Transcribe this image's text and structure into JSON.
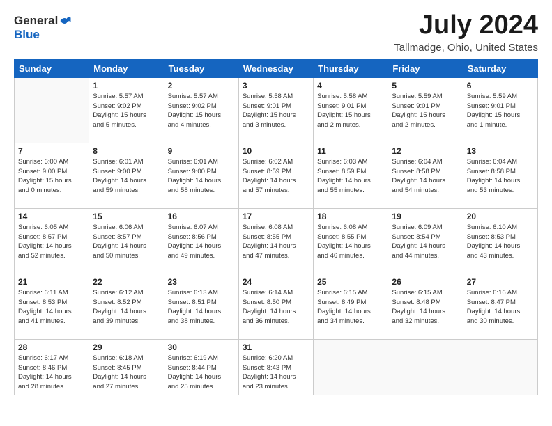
{
  "logo": {
    "general": "General",
    "blue": "Blue"
  },
  "title": "July 2024",
  "location": "Tallmadge, Ohio, United States",
  "headers": [
    "Sunday",
    "Monday",
    "Tuesday",
    "Wednesday",
    "Thursday",
    "Friday",
    "Saturday"
  ],
  "weeks": [
    [
      {
        "num": "",
        "info": ""
      },
      {
        "num": "1",
        "info": "Sunrise: 5:57 AM\nSunset: 9:02 PM\nDaylight: 15 hours\nand 5 minutes."
      },
      {
        "num": "2",
        "info": "Sunrise: 5:57 AM\nSunset: 9:02 PM\nDaylight: 15 hours\nand 4 minutes."
      },
      {
        "num": "3",
        "info": "Sunrise: 5:58 AM\nSunset: 9:01 PM\nDaylight: 15 hours\nand 3 minutes."
      },
      {
        "num": "4",
        "info": "Sunrise: 5:58 AM\nSunset: 9:01 PM\nDaylight: 15 hours\nand 2 minutes."
      },
      {
        "num": "5",
        "info": "Sunrise: 5:59 AM\nSunset: 9:01 PM\nDaylight: 15 hours\nand 2 minutes."
      },
      {
        "num": "6",
        "info": "Sunrise: 5:59 AM\nSunset: 9:01 PM\nDaylight: 15 hours\nand 1 minute."
      }
    ],
    [
      {
        "num": "7",
        "info": "Sunrise: 6:00 AM\nSunset: 9:00 PM\nDaylight: 15 hours\nand 0 minutes."
      },
      {
        "num": "8",
        "info": "Sunrise: 6:01 AM\nSunset: 9:00 PM\nDaylight: 14 hours\nand 59 minutes."
      },
      {
        "num": "9",
        "info": "Sunrise: 6:01 AM\nSunset: 9:00 PM\nDaylight: 14 hours\nand 58 minutes."
      },
      {
        "num": "10",
        "info": "Sunrise: 6:02 AM\nSunset: 8:59 PM\nDaylight: 14 hours\nand 57 minutes."
      },
      {
        "num": "11",
        "info": "Sunrise: 6:03 AM\nSunset: 8:59 PM\nDaylight: 14 hours\nand 55 minutes."
      },
      {
        "num": "12",
        "info": "Sunrise: 6:04 AM\nSunset: 8:58 PM\nDaylight: 14 hours\nand 54 minutes."
      },
      {
        "num": "13",
        "info": "Sunrise: 6:04 AM\nSunset: 8:58 PM\nDaylight: 14 hours\nand 53 minutes."
      }
    ],
    [
      {
        "num": "14",
        "info": "Sunrise: 6:05 AM\nSunset: 8:57 PM\nDaylight: 14 hours\nand 52 minutes."
      },
      {
        "num": "15",
        "info": "Sunrise: 6:06 AM\nSunset: 8:57 PM\nDaylight: 14 hours\nand 50 minutes."
      },
      {
        "num": "16",
        "info": "Sunrise: 6:07 AM\nSunset: 8:56 PM\nDaylight: 14 hours\nand 49 minutes."
      },
      {
        "num": "17",
        "info": "Sunrise: 6:08 AM\nSunset: 8:55 PM\nDaylight: 14 hours\nand 47 minutes."
      },
      {
        "num": "18",
        "info": "Sunrise: 6:08 AM\nSunset: 8:55 PM\nDaylight: 14 hours\nand 46 minutes."
      },
      {
        "num": "19",
        "info": "Sunrise: 6:09 AM\nSunset: 8:54 PM\nDaylight: 14 hours\nand 44 minutes."
      },
      {
        "num": "20",
        "info": "Sunrise: 6:10 AM\nSunset: 8:53 PM\nDaylight: 14 hours\nand 43 minutes."
      }
    ],
    [
      {
        "num": "21",
        "info": "Sunrise: 6:11 AM\nSunset: 8:53 PM\nDaylight: 14 hours\nand 41 minutes."
      },
      {
        "num": "22",
        "info": "Sunrise: 6:12 AM\nSunset: 8:52 PM\nDaylight: 14 hours\nand 39 minutes."
      },
      {
        "num": "23",
        "info": "Sunrise: 6:13 AM\nSunset: 8:51 PM\nDaylight: 14 hours\nand 38 minutes."
      },
      {
        "num": "24",
        "info": "Sunrise: 6:14 AM\nSunset: 8:50 PM\nDaylight: 14 hours\nand 36 minutes."
      },
      {
        "num": "25",
        "info": "Sunrise: 6:15 AM\nSunset: 8:49 PM\nDaylight: 14 hours\nand 34 minutes."
      },
      {
        "num": "26",
        "info": "Sunrise: 6:15 AM\nSunset: 8:48 PM\nDaylight: 14 hours\nand 32 minutes."
      },
      {
        "num": "27",
        "info": "Sunrise: 6:16 AM\nSunset: 8:47 PM\nDaylight: 14 hours\nand 30 minutes."
      }
    ],
    [
      {
        "num": "28",
        "info": "Sunrise: 6:17 AM\nSunset: 8:46 PM\nDaylight: 14 hours\nand 28 minutes."
      },
      {
        "num": "29",
        "info": "Sunrise: 6:18 AM\nSunset: 8:45 PM\nDaylight: 14 hours\nand 27 minutes."
      },
      {
        "num": "30",
        "info": "Sunrise: 6:19 AM\nSunset: 8:44 PM\nDaylight: 14 hours\nand 25 minutes."
      },
      {
        "num": "31",
        "info": "Sunrise: 6:20 AM\nSunset: 8:43 PM\nDaylight: 14 hours\nand 23 minutes."
      },
      {
        "num": "",
        "info": ""
      },
      {
        "num": "",
        "info": ""
      },
      {
        "num": "",
        "info": ""
      }
    ]
  ]
}
